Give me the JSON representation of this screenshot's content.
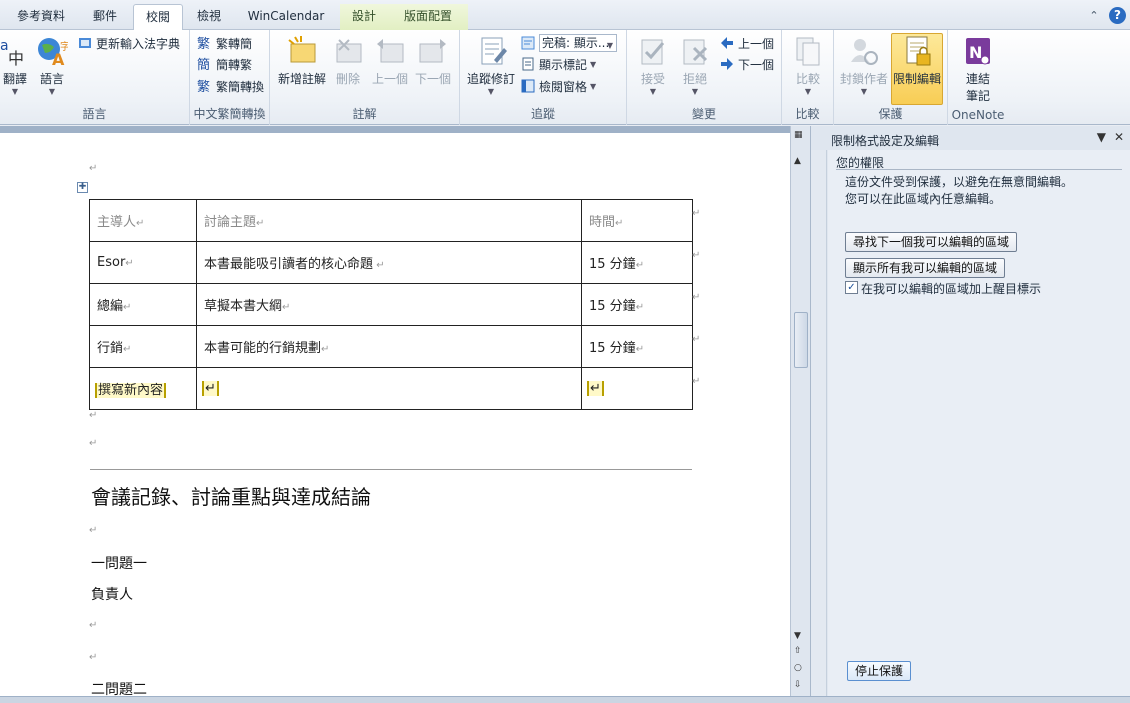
{
  "tabs": [
    "參考資料",
    "郵件",
    "校閱",
    "檢視",
    "WinCalendar",
    "設計",
    "版面配置"
  ],
  "ribbon": {
    "language": {
      "translate": "翻譯",
      "language": "語言",
      "update_ime": "更新輸入法字典",
      "label": "語言"
    },
    "chinese_conv": {
      "to_trad": "繁轉簡",
      "to_simp": "簡轉繁",
      "convert": "繁簡轉換",
      "label": "中文繁簡轉換"
    },
    "comments": {
      "new": "新增註解",
      "delete": "刪除",
      "prev": "上一個",
      "next": "下一個",
      "label": "註解"
    },
    "tracking": {
      "track": "追蹤修訂",
      "display": "完稿: 顯示...",
      "show_markup": "顯示標記",
      "review_pane": "檢閱窗格",
      "label": "追蹤"
    },
    "changes": {
      "accept": "接受",
      "reject": "拒絕",
      "prev": "上一個",
      "next": "下一個",
      "label": "變更"
    },
    "compare": {
      "compare": "比較",
      "label": "比較"
    },
    "protect": {
      "block_authors": "封鎖作者",
      "restrict": "限制編輯",
      "label": "保護"
    },
    "onenote": {
      "linked": "連結\n筆記",
      "linked_l1": "連結",
      "linked_l2": "筆記",
      "label": "OneNote"
    }
  },
  "document": {
    "table": {
      "headers": [
        "主導人",
        "討論主題",
        "時間"
      ],
      "rows": [
        [
          "Esor",
          "本書最能吸引讀者的核心命題",
          "15 分鐘"
        ],
        [
          "總編",
          "草擬本書大綱",
          "15 分鐘"
        ],
        [
          "行銷",
          "本書可能的行銷規劃",
          "15 分鐘"
        ]
      ],
      "editable_row": [
        "撰寫新內容",
        "",
        ""
      ]
    },
    "heading": "會議記錄、討論重點與達成結論",
    "lines": [
      "一問題一",
      "負責人",
      "二問題二"
    ]
  },
  "pane": {
    "title": "限制格式設定及編輯",
    "section_title": "您的權限",
    "desc1": "這份文件受到保護，以避免在無意間編輯。",
    "desc2": "您可以在此區域內任意編輯。",
    "find_next": "尋找下一個我可以編輯的區域",
    "show_all": "顯示所有我可以編輯的區域",
    "highlight": "在我可以編輯的區域加上醒目標示",
    "highlight_checked": true,
    "stop": "停止保護"
  },
  "colors": {
    "accent": "#f8cd55",
    "editable_bracket": "#b8a000"
  }
}
